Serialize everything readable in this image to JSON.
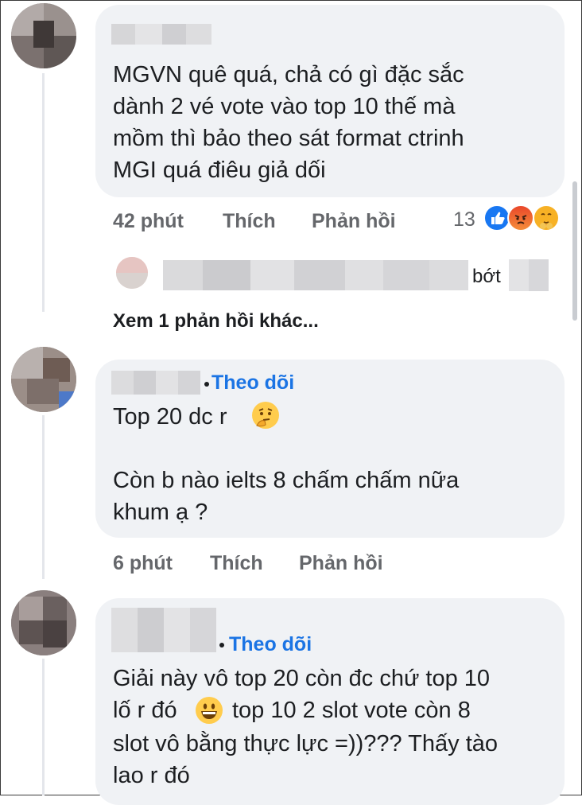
{
  "comments": [
    {
      "text": "MGVN quê quá, chả có gì đặc sắc\ndành 2 vé vote vào top 10 thế mà\nmồm thì bảo theo sát format ctrinh\nMGI quá điêu giả dối",
      "time": "42 phút",
      "like": "Thích",
      "reply": "Phản hồi",
      "reaction_count": "13",
      "reactions": [
        "like-reaction-icon",
        "angry-reaction-icon",
        "care-reaction-icon"
      ]
    },
    {
      "follow": "Theo dõi",
      "text_line1": "Top 20 dc r",
      "text_rest": "Còn b nào ielts 8 chấm chấm nữa\nkhum ạ ?",
      "emoji": "thinking-emoji-icon",
      "time": "6 phút",
      "like": "Thích",
      "reply": "Phản hồi"
    },
    {
      "follow": "Theo dõi",
      "line1": "Giải này vô top 20 còn đc chứ top 10",
      "line2_a": "lố r đó",
      "line2_b": "top 10 2 slot vote còn 8",
      "line3": "slot vô bằng thực lực =))??? Thấy tào",
      "line4": "lao r đó",
      "emoji": "grinning-emoji-icon"
    }
  ],
  "collapsed_reply": {
    "tail": "bớt",
    "more_replies": "Xem 1 phản hồi khác..."
  },
  "colors": {
    "bubble": "#f0f2f5",
    "meta": "#65676b",
    "follow": "#1b74e4",
    "like_blue": "#1877f2",
    "angry": "#f0521f",
    "care": "#f7b125"
  }
}
